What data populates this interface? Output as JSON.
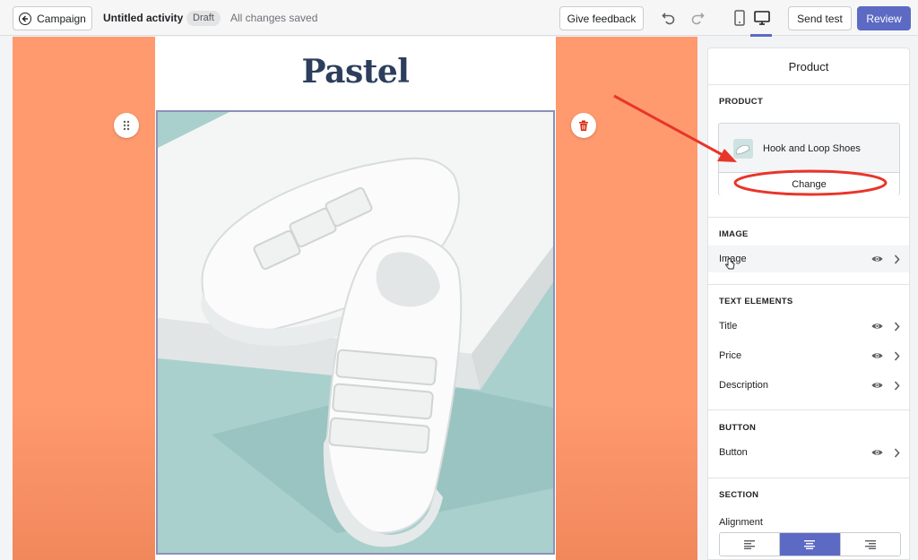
{
  "topbar": {
    "back_label": "Campaign",
    "activity_title": "Untitled activity",
    "status_badge": "Draft",
    "save_status": "All changes saved",
    "feedback_label": "Give feedback",
    "send_test_label": "Send test",
    "review_label": "Review",
    "icons": [
      "back-arrow-icon",
      "undo-icon",
      "redo-icon",
      "mobile-preview-icon",
      "desktop-preview-icon"
    ],
    "active_preview": "desktop"
  },
  "email": {
    "brand": "Pastel",
    "image_subject": "Pair of white hook and loop sneakers on a white block, teal background"
  },
  "panel": {
    "title": "Product",
    "product_section": {
      "heading": "PRODUCT",
      "product_name": "Hook and Loop Shoes",
      "change_label": "Change"
    },
    "image_section": {
      "heading": "IMAGE",
      "rows": [
        {
          "label": "Image"
        }
      ]
    },
    "text_section": {
      "heading": "TEXT ELEMENTS",
      "rows": [
        {
          "label": "Title"
        },
        {
          "label": "Price"
        },
        {
          "label": "Description"
        }
      ]
    },
    "button_section": {
      "heading": "BUTTON",
      "rows": [
        {
          "label": "Button"
        }
      ]
    },
    "section_section": {
      "heading": "SECTION",
      "alignment_label": "Alignment",
      "alignment_options": [
        "left",
        "center",
        "right"
      ],
      "alignment_selected": "center"
    }
  },
  "colors": {
    "accent": "#5c6ac4",
    "canvas_background": "#ff9a6e",
    "brand_text": "#2c3e5c",
    "annotation": "#e8352a"
  }
}
